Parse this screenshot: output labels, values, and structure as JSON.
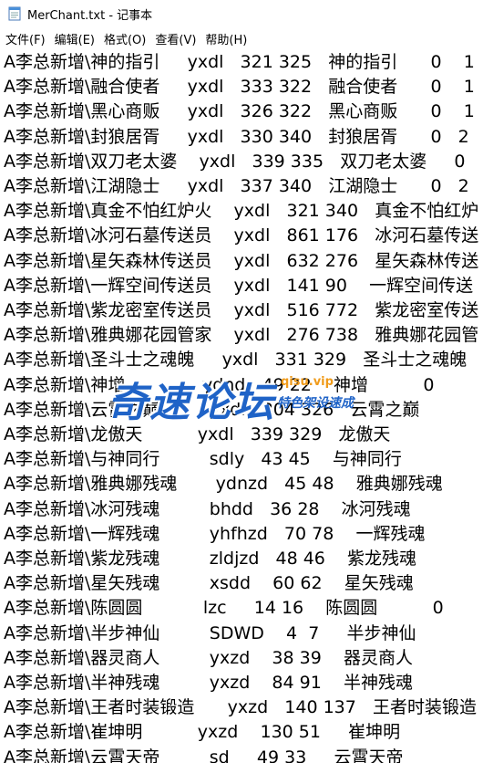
{
  "window": {
    "title": "MerChant.txt - 记事本",
    "app_icon": "notepad-icon"
  },
  "menu": [
    {
      "label": "文件(F)"
    },
    {
      "label": "编辑(E)"
    },
    {
      "label": "格式(O)"
    },
    {
      "label": "查看(V)"
    },
    {
      "label": "帮助(H)"
    }
  ],
  "lines": [
    "A李总新增\\神的指引     yxdl   321 325   神的指引      0    1",
    "A李总新增\\融合使者     yxdl   333 322   融合使者      0    1",
    "A李总新增\\黑心商贩     yxdl   326 322   黑心商贩      0    1",
    "A李总新增\\封狼居胥     yxdl   330 340   封狼居胥      0   2",
    "A李总新增\\双刀老太婆    yxdl   339 335   双刀老太婆     0",
    "A李总新增\\江湖隐士     yxdl   337 340   江湖隐士      0   2",
    "A李总新增\\真金不怕红炉火    yxdl   321 340   真金不怕红炉",
    "A李总新增\\冰河石墓传送员    yxdl   861 176   冰河石墓传送",
    "A李总新增\\星矢森林传送员    yxdl   632 276   星矢森林传送",
    "A李总新增\\一辉空间传送员    yxdl   141 90    一辉空间传送",
    "A李总新增\\紫龙密室传送员    yxdl   516 772   紫龙密室传送",
    "A李总新增\\雅典娜花园管家    yxdl   276 738   雅典娜花园管",
    "A李总新增\\圣斗士之魂魄     yxdl   331 329   圣斗士之魂魄",
    "A李总新增\\神增              ydnd   49 22    神增          0",
    "A李总新增\\云霄之巅         yxdl   304 326   云霄之巅",
    "A李总新增\\龙傲天          yxdl   339 329   龙傲天",
    "A李总新增\\与神同行         sdly   43 45    与神同行",
    "A李总新增\\雅典娜残魂       ydnzd   45 48    雅典娜残魂",
    "A李总新增\\冰河残魂         bhdd   36 28    冰河残魂",
    "A李总新增\\一辉残魂         yhfhzd   70 78    一辉残魂",
    "A李总新增\\紫龙残魂         zldjzd   48 46    紫龙残魂",
    "A李总新增\\星矢残魂         xsdd    60 62    星矢残魂",
    "A李总新增\\陈圆圆           lzc     14 16    陈圆圆          0",
    "A李总新增\\半步神仙         SDWD    4  7     半步神仙",
    "A李总新增\\器灵商人         yxzd    38 39    器灵商人",
    "A李总新增\\半神残魂         yxzd    84 91    半神残魂",
    "A李总新增\\王者时装锻造      yxzd   140 137   王者时装锻造",
    "A李总新增\\崔坤明          yxzd    130 51     崔坤明",
    "A李总新增\\云霄天帝         sd     49 33     云霄天帝"
  ],
  "watermark": {
    "main": "奇速论坛",
    "url": "qisu.vip",
    "sub": "特色架设速成"
  }
}
